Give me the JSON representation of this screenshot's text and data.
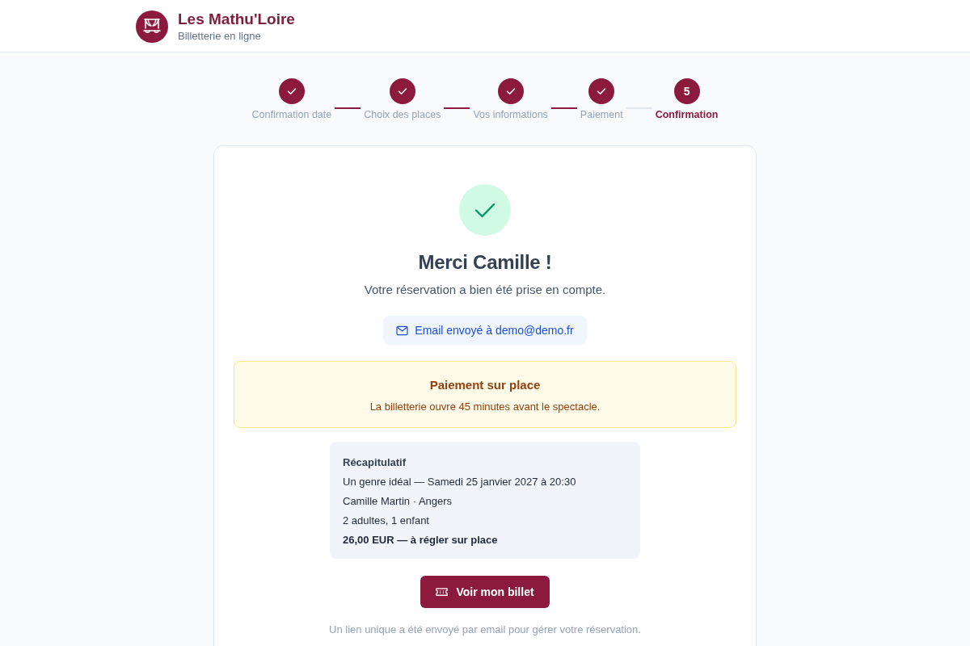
{
  "header": {
    "title": "Les Mathu'Loire",
    "subtitle": "Billetterie en ligne"
  },
  "steps": [
    {
      "label": "Confirmation date",
      "completed": true,
      "selected": false
    },
    {
      "label": "Choix des places",
      "completed": true,
      "selected": false
    },
    {
      "label": "Vos informations",
      "completed": true,
      "selected": false
    },
    {
      "label": "Paiement",
      "completed": true,
      "selected": false
    },
    {
      "label": "Confirmation",
      "number": "5",
      "completed": false,
      "selected": true
    }
  ],
  "confirmation": {
    "title": "Merci Camille !",
    "subtitle": "Votre réservation a bien été prise en compte.",
    "email_notice": "Email envoyé à demo@demo.fr"
  },
  "alert": {
    "title": "Paiement sur place",
    "text": "La billetterie ouvre 45 minutes avant le spectacle."
  },
  "summary": {
    "title": "Récapitulatif",
    "lines": [
      {
        "text": "Un genre idéal — Samedi 25 janvier 2027 à 20:30",
        "bold": false
      },
      {
        "text": "Camille Martin · Angers",
        "bold": false
      },
      {
        "text": "2 adultes, 1 enfant",
        "bold": false
      },
      {
        "text": "26,00 EUR — à régler sur place",
        "bold": true
      }
    ]
  },
  "button": {
    "label": "Voir mon billet"
  },
  "footer_note": "Un lien unique a été envoyé par email pour gérer votre réservation."
}
